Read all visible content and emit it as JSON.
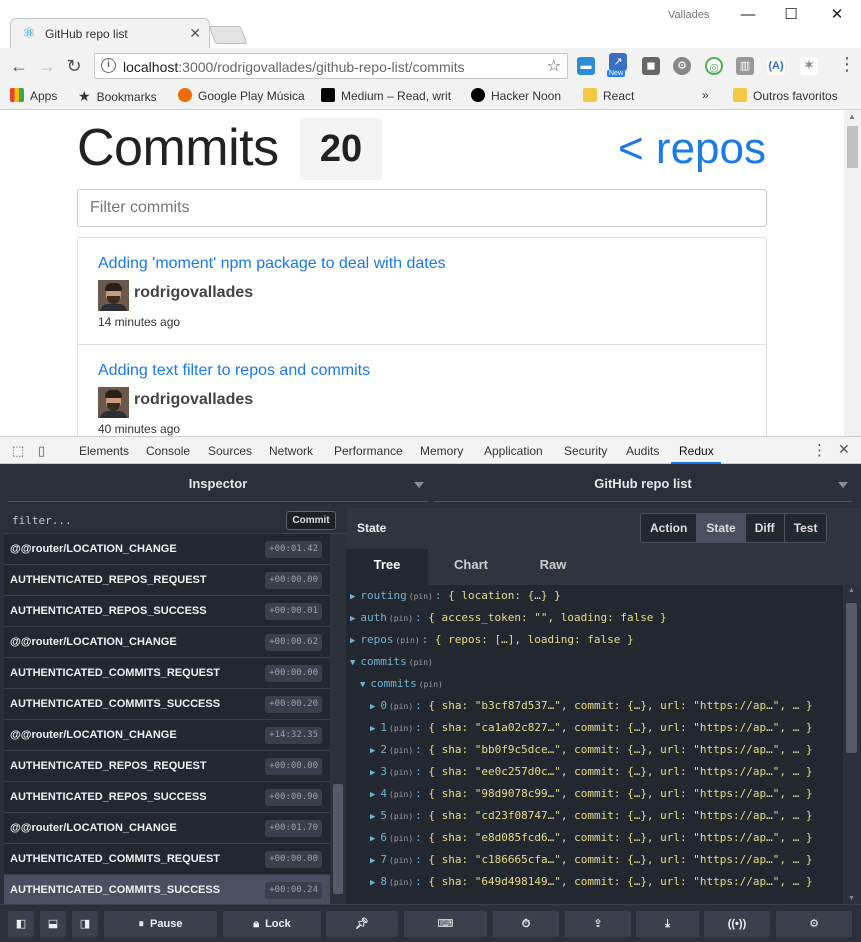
{
  "browser": {
    "tab_title": "GitHub repo list",
    "user_name": "Vallades",
    "url_host": "localhost",
    "url_path": ":3000/rodrigovallades/github-repo-list/commits",
    "new_badge": "New",
    "bookmarks": [
      {
        "label": "Apps",
        "icon": "apps-grid-icon",
        "color": "#4285f4"
      },
      {
        "label": "Bookmarks",
        "icon": "star-icon",
        "color": "#555555"
      },
      {
        "label": "Google Play Música",
        "icon": "play-music-icon",
        "color": "#ef6c00"
      },
      {
        "label": "Medium – Read, writ",
        "icon": "medium-icon",
        "color": "#000000"
      },
      {
        "label": "Hacker Noon",
        "icon": "hacker-noon-icon",
        "color": "#000000"
      },
      {
        "label": "React",
        "icon": "folder-icon",
        "color": "#f5c842"
      }
    ],
    "bookmarks_overflow": "»",
    "other_bookmarks": "Outros favoritos"
  },
  "page": {
    "heading": "Commits",
    "count": "20",
    "repos_link": "< repos",
    "filter_placeholder": "Filter commits",
    "commits": [
      {
        "message": "Adding 'moment' npm package to deal with dates",
        "author": "rodrigovallades",
        "time": "14 minutes ago"
      },
      {
        "message": "Adding text filter to repos and commits",
        "author": "rodrigovallades",
        "time": "40 minutes ago"
      }
    ]
  },
  "devtools": {
    "tabs": [
      "Elements",
      "Console",
      "Sources",
      "Network",
      "Performance",
      "Memory",
      "Application",
      "Security",
      "Audits",
      "Redux"
    ],
    "active_tab": "Redux"
  },
  "redux": {
    "inspector_label": "Inspector",
    "instance_label": "GitHub repo list",
    "filter_placeholder": "filter...",
    "commit_button": "Commit",
    "actions": [
      {
        "name": "@@router/LOCATION_CHANGE",
        "time": "+00:01.42"
      },
      {
        "name": "AUTHENTICATED_REPOS_REQUEST",
        "time": "+00:00.00"
      },
      {
        "name": "AUTHENTICATED_REPOS_SUCCESS",
        "time": "+00:00.01"
      },
      {
        "name": "@@router/LOCATION_CHANGE",
        "time": "+00:00.62"
      },
      {
        "name": "AUTHENTICATED_COMMITS_REQUEST",
        "time": "+00:00.00"
      },
      {
        "name": "AUTHENTICATED_COMMITS_SUCCESS",
        "time": "+00:00.20"
      },
      {
        "name": "@@router/LOCATION_CHANGE",
        "time": "+14:32.35"
      },
      {
        "name": "AUTHENTICATED_REPOS_REQUEST",
        "time": "+00:00.00"
      },
      {
        "name": "AUTHENTICATED_REPOS_SUCCESS",
        "time": "+00:00.90"
      },
      {
        "name": "@@router/LOCATION_CHANGE",
        "time": "+00:01.70"
      },
      {
        "name": "AUTHENTICATED_COMMITS_REQUEST",
        "time": "+00:00.00"
      },
      {
        "name": "AUTHENTICATED_COMMITS_SUCCESS",
        "time": "+00:00.24"
      }
    ],
    "selected_action_index": 11,
    "state_label": "State",
    "modes": [
      "Action",
      "State",
      "Diff",
      "Test"
    ],
    "active_mode": "State",
    "subtabs": [
      "Tree",
      "Chart",
      "Raw"
    ],
    "active_subtab": "Tree",
    "tree": [
      {
        "arrow": "▶",
        "key": "routing",
        "value": "{ location: {…} }"
      },
      {
        "arrow": "▶",
        "key": "auth",
        "value": "{ access_token: \"\", loading: false }"
      },
      {
        "arrow": "▶",
        "key": "repos",
        "value": "{ repos: […], loading: false }"
      },
      {
        "arrow": "▼",
        "key": "commits",
        "value": ""
      },
      {
        "arrow": "▼",
        "key": "commits",
        "value": ""
      },
      {
        "arrow": "▶",
        "key": "0",
        "value": "{ sha: \"b3cf87d537…\", commit: {…}, url: \"https://ap…\", … }"
      },
      {
        "arrow": "▶",
        "key": "1",
        "value": "{ sha: \"ca1a02c827…\", commit: {…}, url: \"https://ap…\", … }"
      },
      {
        "arrow": "▶",
        "key": "2",
        "value": "{ sha: \"bb0f9c5dce…\", commit: {…}, url: \"https://ap…\", … }"
      },
      {
        "arrow": "▶",
        "key": "3",
        "value": "{ sha: \"ee0c257d0c…\", commit: {…}, url: \"https://ap…\", … }"
      },
      {
        "arrow": "▶",
        "key": "4",
        "value": "{ sha: \"98d9078c99…\", commit: {…}, url: \"https://ap…\", … }"
      },
      {
        "arrow": "▶",
        "key": "5",
        "value": "{ sha: \"cd23f08747…\", commit: {…}, url: \"https://ap…\", … }"
      },
      {
        "arrow": "▶",
        "key": "6",
        "value": "{ sha: \"e8d085fcd6…\", commit: {…}, url: \"https://ap…\", … }"
      },
      {
        "arrow": "▶",
        "key": "7",
        "value": "{ sha: \"c186665cfa…\", commit: {…}, url: \"https://ap…\", … }"
      },
      {
        "arrow": "▶",
        "key": "8",
        "value": "{ sha: \"649d498149…\", commit: {…}, url: \"https://ap…\", … }"
      }
    ],
    "pin_label": "(pin)",
    "footer": {
      "pause": "Pause",
      "lock": "Lock"
    }
  },
  "colors": {
    "link_blue": "#1a7ae8",
    "redux_bg": "#2a2f3a",
    "tree_key": "#6fb3d2",
    "tree_value": "#e6dc8a"
  }
}
